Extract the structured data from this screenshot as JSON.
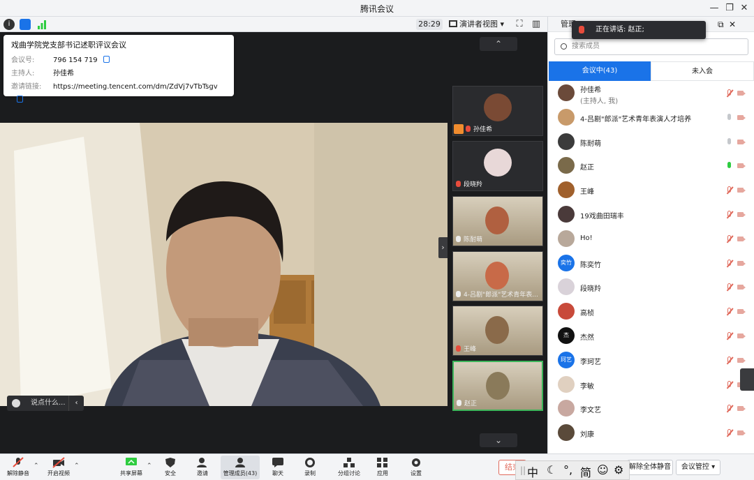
{
  "window": {
    "title": "腾讯会议"
  },
  "toolbar": {
    "timer": "28:29",
    "view_label": "演讲者视图"
  },
  "meeting_info": {
    "title": "戏曲学院党支部书记述职评议会议",
    "id_label": "会议号:",
    "id_value": "796 154 719",
    "host_label": "主持人:",
    "host_value": "孙佳希",
    "link_label": "邀请链接:",
    "link_value": "https://meeting.tencent.com/dm/ZdVj7vTbTsgv"
  },
  "chat": {
    "placeholder": "说点什么..."
  },
  "gallery": [
    {
      "name": "孙佳希",
      "mic": "muted",
      "host": true
    },
    {
      "name": "段晓羚",
      "mic": "muted",
      "host": false
    },
    {
      "name": "陈耐萌",
      "mic": "on",
      "host": false
    },
    {
      "name": "4-吕剧\"郎派\"艺术青年表...",
      "mic": "on",
      "host": false
    },
    {
      "name": "王峰",
      "mic": "muted",
      "host": false
    },
    {
      "name": "赵正",
      "mic": "live",
      "host": false
    }
  ],
  "panel": {
    "header": "管理",
    "speaking_label": "正在讲话: 赵正;",
    "search_placeholder": "搜索成员",
    "tab_in": "会议中(43)",
    "tab_out": "未入会"
  },
  "members": [
    {
      "name": "孙佳希",
      "sub": "(主持人, 我)",
      "mic": "off",
      "avatar_color": "#6b4a3a"
    },
    {
      "name": "4-吕剧\"郎派\"艺术青年表演人才培养",
      "sub": "",
      "mic": "on",
      "avatar_color": "#c89a6a"
    },
    {
      "name": "陈耐萌",
      "sub": "",
      "mic": "on",
      "avatar_color": "#3b3b3b"
    },
    {
      "name": "赵正",
      "sub": "",
      "mic": "live",
      "avatar_color": "#7a6a4a"
    },
    {
      "name": "王峰",
      "sub": "",
      "mic": "off",
      "avatar_color": "#a0602c"
    },
    {
      "name": "19戏曲田瑞丰",
      "sub": "",
      "mic": "off",
      "avatar_color": "#4a3a3a"
    },
    {
      "name": "Ho!",
      "sub": "",
      "mic": "off",
      "avatar_color": "#b8a89a"
    },
    {
      "name": "陈奕竹",
      "sub": "",
      "mic": "off",
      "avatar_color": "#1a73e8",
      "initials": "奕竹"
    },
    {
      "name": "段晓羚",
      "sub": "",
      "mic": "off",
      "avatar_color": "#d9d2d9"
    },
    {
      "name": "高桢",
      "sub": "",
      "mic": "off",
      "avatar_color": "#c84a3a"
    },
    {
      "name": "杰然",
      "sub": "",
      "mic": "off",
      "avatar_color": "#111111",
      "initials": "杰"
    },
    {
      "name": "李珂艺",
      "sub": "",
      "mic": "off",
      "avatar_color": "#1a73e8",
      "initials": "珂艺"
    },
    {
      "name": "李敏",
      "sub": "",
      "mic": "off",
      "avatar_color": "#e0d0c0"
    },
    {
      "name": "李文艺",
      "sub": "",
      "mic": "off",
      "avatar_color": "#c8a8a0"
    },
    {
      "name": "刘康",
      "sub": "",
      "mic": "off",
      "avatar_color": "#5a4a3a"
    }
  ],
  "bottom": {
    "unmute": "解除静音",
    "video": "开启视频",
    "share": "共享屏幕",
    "security": "安全",
    "invite": "邀请",
    "members": "管理成员(43)",
    "chat": "聊天",
    "record": "录制",
    "breakout": "分组讨论",
    "apps": "应用",
    "settings": "设置",
    "end": "结束",
    "mute_all": "解除全体静音",
    "control": "会议管控"
  },
  "ime": {
    "lang": "中",
    "punct": "°,",
    "mode": "简"
  }
}
